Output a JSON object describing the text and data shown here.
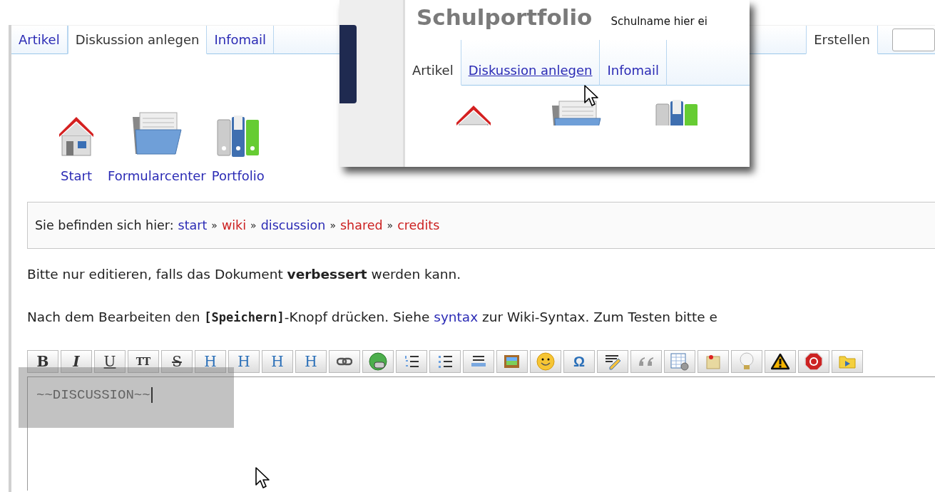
{
  "header_tabs": [
    {
      "label": "Artikel",
      "selected": false
    },
    {
      "label": "Diskussion anlegen",
      "selected": true
    },
    {
      "label": "Infomail",
      "selected": false
    }
  ],
  "action_tabs": [
    {
      "label": "Erstellen",
      "selected": true
    }
  ],
  "nav_icons": [
    {
      "label": "Start",
      "kind": "house"
    },
    {
      "label": "Formularcenter",
      "kind": "folder"
    },
    {
      "label": "Portfolio",
      "kind": "binders"
    }
  ],
  "breadcrumb": {
    "label": "Sie befinden sich hier:",
    "separators": [
      "»",
      "»",
      "»",
      "»"
    ],
    "trail": [
      {
        "text": "start",
        "kind": "existing"
      },
      {
        "text": "wiki",
        "kind": "missing"
      },
      {
        "text": "discussion",
        "kind": "existing"
      },
      {
        "text": "shared",
        "kind": "missing"
      },
      {
        "text": "credits",
        "kind": "missing"
      }
    ]
  },
  "notices": [
    {
      "parts": [
        {
          "kind": "text",
          "text": "Bitte nur editieren, falls das Dokument **verbessert** werden kann."
        }
      ]
    },
    {
      "parts": [
        {
          "kind": "text",
          "text": "Nach dem Bearbeiten den "
        },
        {
          "kind": "code",
          "text": "[Speichern]"
        },
        {
          "kind": "text",
          "text": "-Knopf drücken. Siehe "
        },
        {
          "kind": "link",
          "text": "syntax"
        },
        {
          "kind": "text",
          "text": " zur Wiki-Syntax. Zum Testen bitte e"
        }
      ]
    }
  ],
  "toolbar": [
    {
      "kind": "bold",
      "label": "B"
    },
    {
      "kind": "italic",
      "label": "I"
    },
    {
      "kind": "underline",
      "label": "U"
    },
    {
      "kind": "mono",
      "label": "TT"
    },
    {
      "kind": "strike",
      "label": "S"
    },
    {
      "kind": "heading-same",
      "label": "H"
    },
    {
      "kind": "heading-lower",
      "label": "H"
    },
    {
      "kind": "heading-higher",
      "label": "H"
    },
    {
      "kind": "heading-menu",
      "label": "H"
    },
    {
      "kind": "link"
    },
    {
      "kind": "extlink"
    },
    {
      "kind": "ol"
    },
    {
      "kind": "ul"
    },
    {
      "kind": "hr"
    },
    {
      "kind": "image"
    },
    {
      "kind": "smiley"
    },
    {
      "kind": "omega",
      "label": "Ω"
    },
    {
      "kind": "signature"
    },
    {
      "kind": "quote"
    },
    {
      "kind": "table"
    },
    {
      "kind": "note"
    },
    {
      "kind": "tip"
    },
    {
      "kind": "warning"
    },
    {
      "kind": "stop"
    },
    {
      "kind": "media"
    }
  ],
  "editor": {
    "value": "~~DISCUSSION~~"
  },
  "inset": {
    "title": "Schulportfolio",
    "subtitle": "Schulname hier ei",
    "tabs": [
      {
        "label": "Artikel",
        "selected": true,
        "hovered": false
      },
      {
        "label": "Diskussion anlegen",
        "selected": false,
        "hovered": true
      },
      {
        "label": "Infomail",
        "selected": false,
        "hovered": false
      }
    ]
  }
}
